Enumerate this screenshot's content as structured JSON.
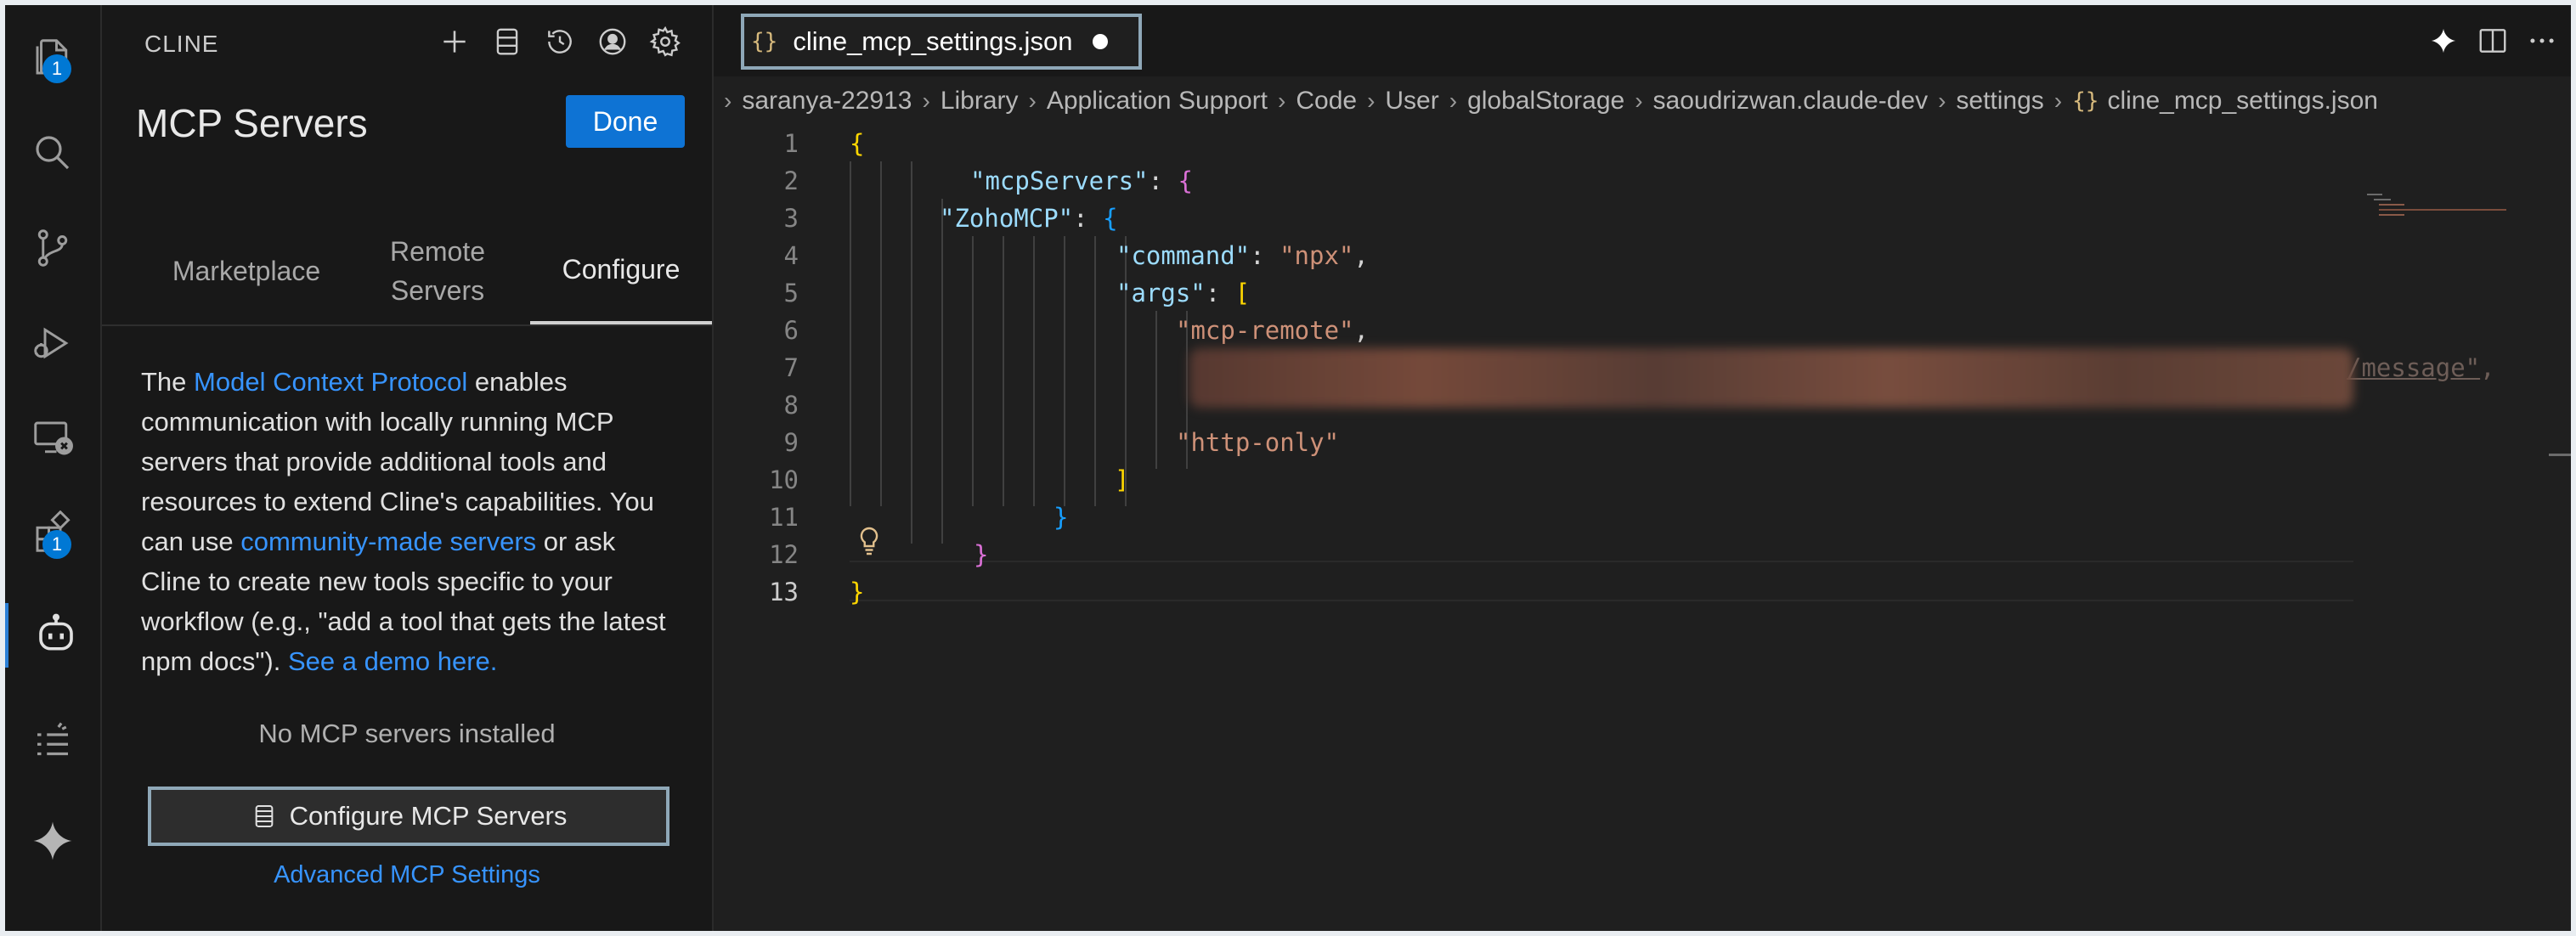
{
  "activity_bar": {
    "explorer_badge": "1",
    "extensions_badge": "1",
    "icons": [
      "files-icon",
      "search-icon",
      "source-control-icon",
      "run-debug-icon",
      "remote-explorer-icon",
      "extensions-icon",
      "cline-icon",
      "list-icon",
      "sparkle-icon"
    ]
  },
  "panel": {
    "title": "CLINE",
    "heading": "MCP Servers",
    "done_label": "Done",
    "tabs": [
      {
        "label": "Marketplace"
      },
      {
        "label": "Remote\nServers"
      },
      {
        "label": "Configure"
      }
    ],
    "description": {
      "t1": "The ",
      "link1": "Model Context Protocol",
      "t2": " enables communication with locally running MCP servers that provide additional tools and resources to extend Cline's capabilities. You can use ",
      "link2": "community-made servers",
      "t3": " or ask Cline to create new tools specific to your workflow (e.g., \"add a tool that gets the latest npm docs\"). ",
      "link3": "See a demo here."
    },
    "empty_text": "No MCP servers installed",
    "configure_button": "Configure MCP Servers",
    "advanced_link": "Advanced MCP Settings"
  },
  "editor": {
    "tab": {
      "icon": "{}",
      "name": "cline_mcp_settings.json"
    },
    "breadcrumbs": [
      "saranya-22913",
      "Library",
      "Application Support",
      "Code",
      "User",
      "globalStorage",
      "saoudrizwan.claude-dev",
      "settings"
    ],
    "breadcrumb_file": "cline_mcp_settings.json",
    "line_numbers": [
      "1",
      "2",
      "3",
      "4",
      "5",
      "6",
      "7",
      "8",
      "9",
      "10",
      "11",
      "12",
      "13"
    ],
    "code": {
      "l1": "{",
      "l2_key": "\"mcpServers\"",
      "l2_brace": "{",
      "l3_key": "\"ZohoMCP\"",
      "l3_brace": "{",
      "l4_key": "\"command\"",
      "l4_val": "\"npx\"",
      "l5_key": "\"args\"",
      "l5_brack": "[",
      "l6_val": "\"mcp-remote\"",
      "l7_tail": "/message\"",
      "l9_val": "\"http-only\"",
      "l10": "]",
      "l11": "}",
      "l12": "}",
      "l13": "}"
    }
  }
}
